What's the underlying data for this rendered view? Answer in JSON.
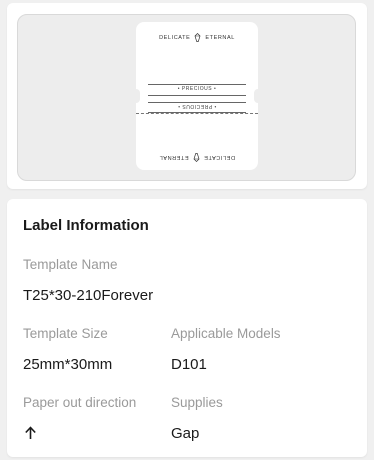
{
  "preview": {
    "brand_left": "DELICATE",
    "brand_right": "ETERNAL",
    "precious_text": "• PRECIOUS •"
  },
  "info": {
    "title": "Label Information",
    "template_name_label": "Template Name",
    "template_name_value": "T25*30-210Forever",
    "template_size_label": "Template Size",
    "template_size_value": "25mm*30mm",
    "applicable_models_label": "Applicable Models",
    "applicable_models_value": "D101",
    "paper_out_label": "Paper out direction",
    "paper_out_icon": "arrow-up-icon",
    "supplies_label": "Supplies",
    "supplies_value": "Gap"
  }
}
